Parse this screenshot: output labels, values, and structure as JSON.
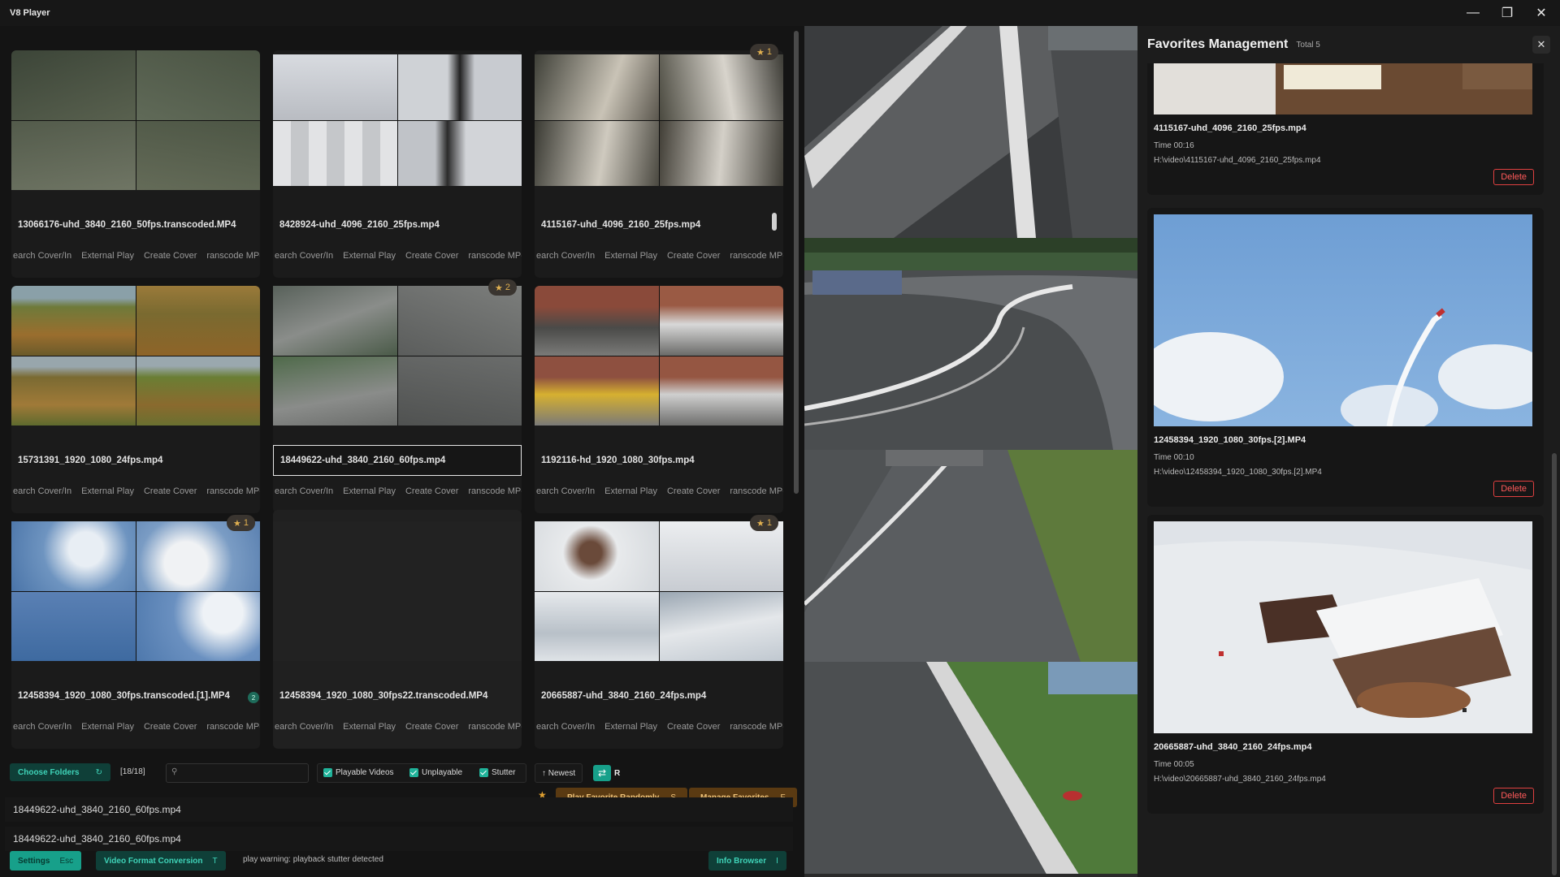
{
  "app": {
    "title": "V8 Player"
  },
  "window_controls": {
    "minimize": "—",
    "maximize": "❐",
    "close": "✕"
  },
  "videos": [
    {
      "name": "13066176-uhd_3840_2160_50fps.transcoded.MP4",
      "favorites": null
    },
    {
      "name": "8428924-uhd_4096_2160_25fps.mp4",
      "favorites": null
    },
    {
      "name": "4115167-uhd_4096_2160_25fps.mp4",
      "favorites": "1"
    },
    {
      "name": "15731391_1920_1080_24fps.mp4",
      "favorites": null
    },
    {
      "name": "18449622-uhd_3840_2160_60fps.mp4",
      "favorites": "2"
    },
    {
      "name": "1192116-hd_1920_1080_30fps.mp4",
      "favorites": null
    },
    {
      "name": "12458394_1920_1080_30fps.transcoded.[1].MP4",
      "favorites": "1"
    },
    {
      "name": "12458394_1920_1080_30fps22.transcoded.MP4",
      "favorites": null
    },
    {
      "name": "20665887-uhd_3840_2160_24fps.mp4",
      "favorites": "1"
    }
  ],
  "card_actions": {
    "search_cover": "earch Cover/In",
    "external_play": "External Play",
    "create_cover": "Create Cover",
    "transcode": "ranscode MP-"
  },
  "card_badge_count": "2",
  "toolbar": {
    "choose_folders": "Choose Folders",
    "refresh_icon": "↻",
    "count": "[18/18]",
    "search_placeholder": "",
    "search_value": "",
    "playable_videos": "Playable Videos",
    "unplayable": "Unplayable",
    "stutter": "Stutter",
    "sort": "↑ Newest",
    "repeat_key": "R",
    "star": "★",
    "play_favorite_randomly": "Play Favorite Randomly",
    "play_favorite_key": "S",
    "manage_favorites": "Manage Favorites",
    "manage_favorites_key": "F"
  },
  "recent": [
    "18449622-uhd_3840_2160_60fps.mp4",
    "18449622-uhd_3840_2160_60fps.mp4"
  ],
  "statusbar": {
    "settings": "Settings",
    "settings_key": "Esc",
    "video_format_conversion": "Video Format Conversion",
    "video_format_key": "T",
    "message": "play warning: playback stutter detected",
    "info_browser": "Info Browser",
    "info_browser_key": "I"
  },
  "favorites": {
    "title": "Favorites Management",
    "total": "Total 5",
    "close": "✕",
    "delete_label": "Delete",
    "items": [
      {
        "name": "4115167-uhd_4096_2160_25fps.mp4",
        "time": "Time 00:16",
        "path": "H:\\video\\4115167-uhd_4096_2160_25fps.mp4"
      },
      {
        "name": "12458394_1920_1080_30fps.[2].MP4",
        "time": "Time 00:10",
        "path": "H:\\video\\12458394_1920_1080_30fps.[2].MP4"
      },
      {
        "name": "20665887-uhd_3840_2160_24fps.mp4",
        "time": "Time 00:05",
        "path": "H:\\video\\20665887-uhd_3840_2160_24fps.mp4"
      }
    ]
  }
}
